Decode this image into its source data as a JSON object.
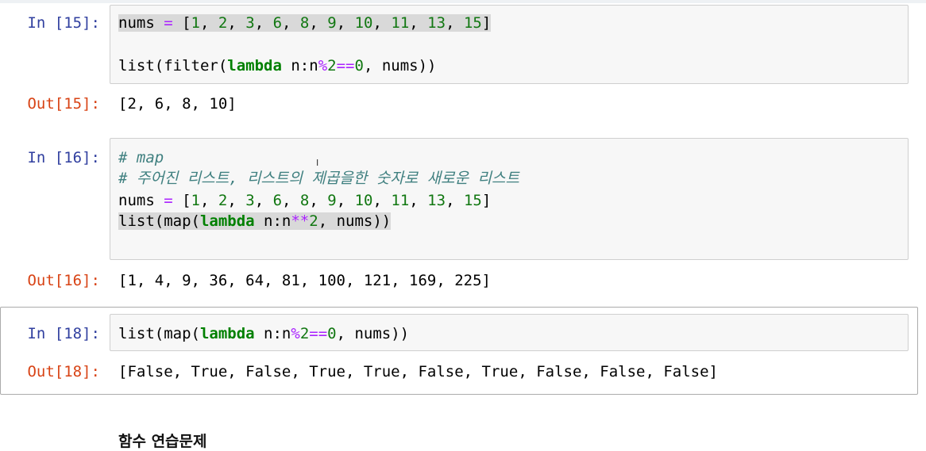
{
  "cells": [
    {
      "in_prompt": "In [15]:",
      "out_prompt": "Out[15]:",
      "code": [
        "nums = [1, 2, 3, 6, 8, 9, 10, 11, 13, 15]",
        "list(filter(lambda n:n%2==0, nums))"
      ],
      "output": "[2, 6, 8, 10]"
    },
    {
      "in_prompt": "In [16]:",
      "out_prompt": "Out[16]:",
      "code": [
        "# map",
        "# 주어진 리스트, 리스트의 제곱을한 숫자로 새로운 리스트",
        "nums = [1, 2, 3, 6, 8, 9, 10, 11, 13, 15]",
        "list(map(lambda n:n**2, nums))"
      ],
      "output": "[1, 4, 9, 36, 64, 81, 100, 121, 169, 225]"
    },
    {
      "in_prompt": "In [18]:",
      "out_prompt": "Out[18]:",
      "code": [
        "list(map(lambda n:n%2==0, nums))"
      ],
      "output": "[False, True, False, True, True, False, True, False, False, False]",
      "selected": true
    }
  ],
  "markdown_heading": "함수 연습문제",
  "colors": {
    "in_prompt": "#303f9f",
    "out_prompt": "#d84315",
    "number": "#117711",
    "operator": "#aa22ff",
    "keyword": "#008000",
    "comment": "#408080"
  }
}
